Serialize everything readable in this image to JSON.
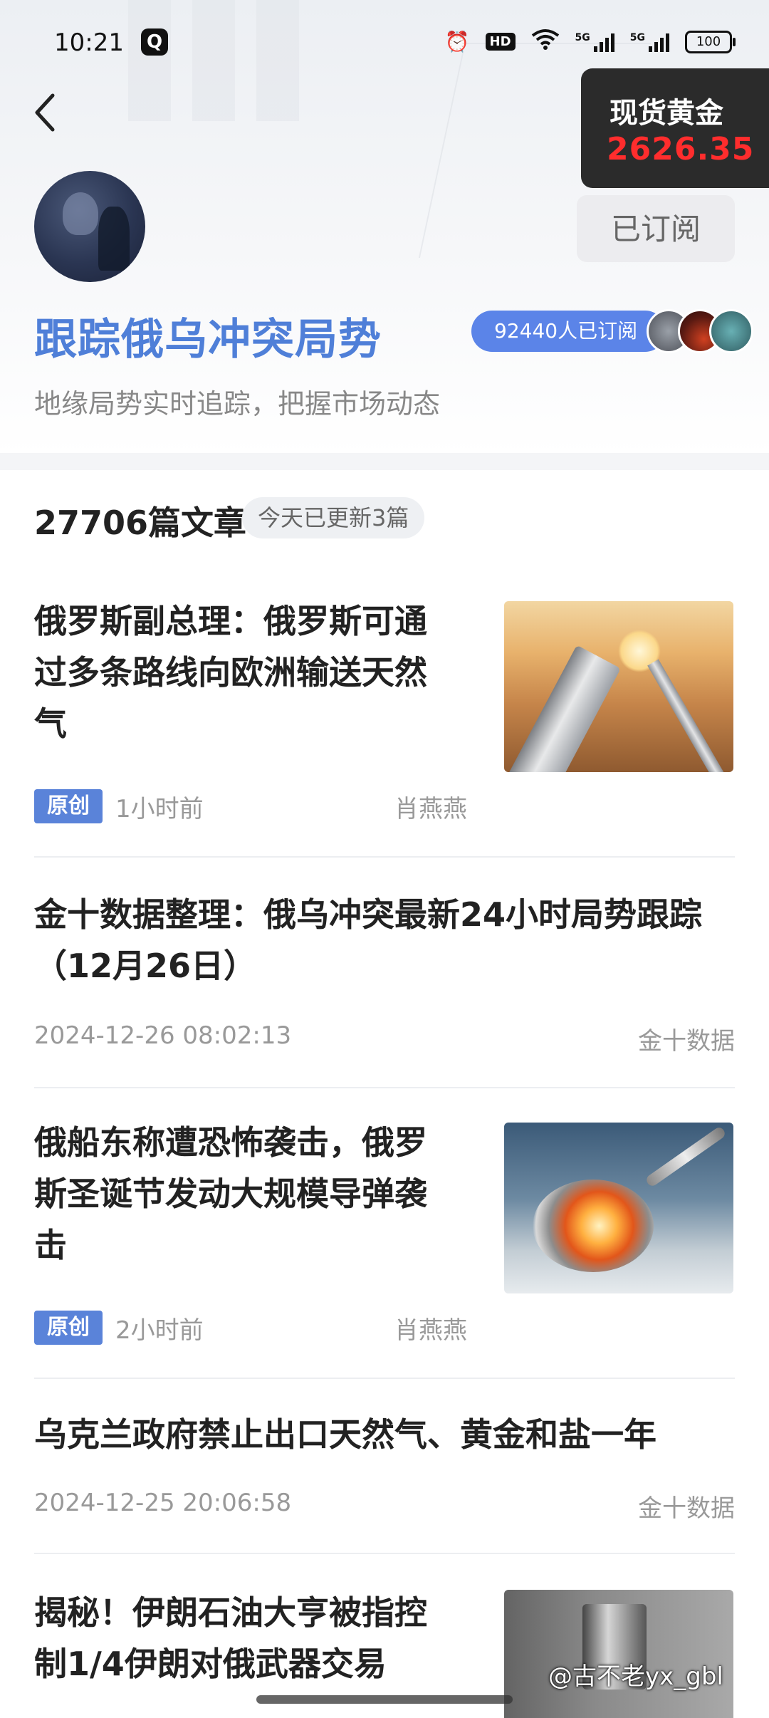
{
  "status": {
    "time": "10:21",
    "app_badge": "Q",
    "hd": "HD",
    "net1": "5G",
    "net2": "5G",
    "battery": "100"
  },
  "gold": {
    "label": "现货黄金",
    "value": "2626.35",
    "value_color": "#ff2d2d"
  },
  "topic": {
    "title": "跟踪俄乌冲突局势",
    "subscribed_label": "已订阅",
    "subscriber_count_text": "92440人已订阅",
    "description": "地缘局势实时追踪，把握市场动态",
    "title_color": "#4f7fd8"
  },
  "list_header": {
    "article_count": "27706篇文章",
    "updated_today": "今天已更新3篇"
  },
  "articles": [
    {
      "title_line1": "俄罗斯副总理：俄罗斯可通",
      "title_line2": "过多条路线向欧洲输送天然",
      "title_line3": "气",
      "tag": "原创",
      "time": "1小时前",
      "author": "肖燕燕",
      "thumb_icon": "pipeline-image"
    },
    {
      "title_line1": "金十数据整理：俄乌冲突最新24小时局势跟踪",
      "title_line2": "（12月26日）",
      "time": "2024-12-26 08:02:13",
      "author": "金十数据"
    },
    {
      "title_line1": "俄船东称遭恐怖袭击，俄罗",
      "title_line2": "斯圣诞节发动大规模导弹袭",
      "title_line3": "击",
      "tag": "原创",
      "time": "2小时前",
      "author": "肖燕燕",
      "thumb_icon": "missile-image"
    },
    {
      "title_line1": "乌克兰政府禁止出口天然气、黄金和盐一年",
      "time": "2024-12-25 20:06:58",
      "author": "金十数据"
    },
    {
      "title_line1": "揭秘！伊朗石油大亨被指控",
      "title_line2": "制1/4伊朗对俄武器交易",
      "thumb_icon": "iran-image"
    }
  ],
  "watermark": "@古不老yx_gbl",
  "colors": {
    "accent": "#5b84e8",
    "tag_bg": "#5a83d9"
  }
}
